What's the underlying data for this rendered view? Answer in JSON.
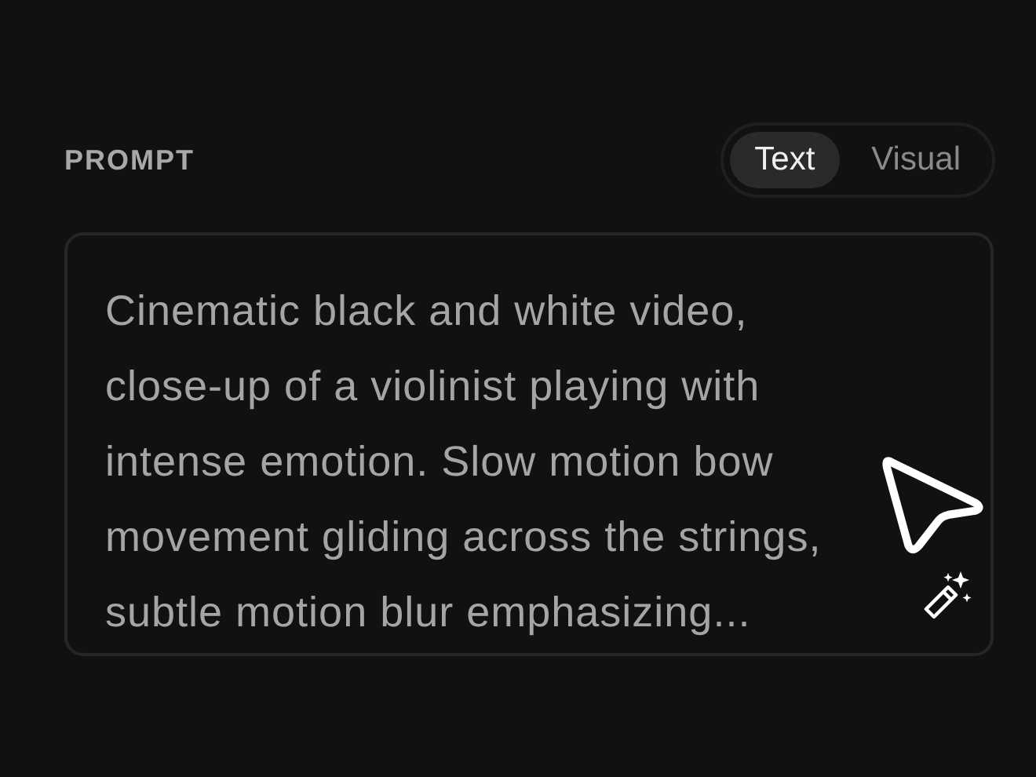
{
  "section_label": "PROMPT",
  "mode_tabs": [
    {
      "label": "Text",
      "selected": true
    },
    {
      "label": "Visual",
      "selected": false
    }
  ],
  "prompt": {
    "value": "Cinematic black and white video,\nclose-up of a violinist playing with\nintense emotion. Slow motion bow\nmovement gliding across the strings,\nsubtle motion blur emphasizing..."
  }
}
